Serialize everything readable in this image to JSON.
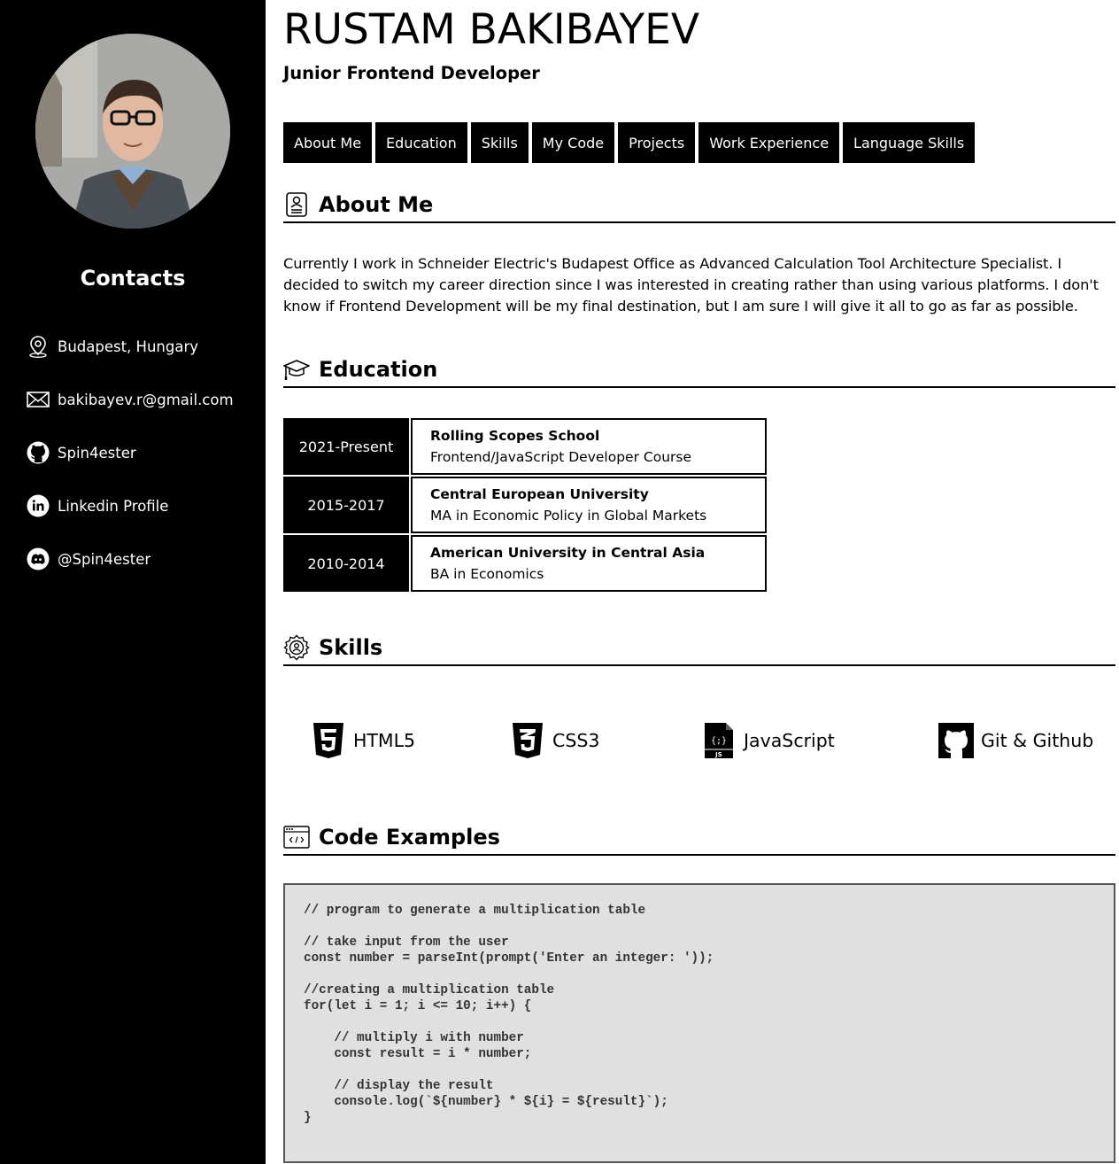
{
  "profile": {
    "name": "RUSTAM BAKIBAYEV",
    "role": "Junior Frontend Developer"
  },
  "sidebar": {
    "contacts_title": "Contacts",
    "contacts": [
      {
        "icon": "location-pin-icon",
        "label": "Budapest, Hungary"
      },
      {
        "icon": "envelope-icon",
        "label": "bakibayev.r@gmail.com"
      },
      {
        "icon": "github-icon",
        "label": "Spin4ester"
      },
      {
        "icon": "linkedin-icon",
        "label": "Linkedin Profile"
      },
      {
        "icon": "discord-icon",
        "label": "@Spin4ester"
      }
    ]
  },
  "nav": {
    "items": [
      "About Me",
      "Education",
      "Skills",
      "My Code",
      "Projects",
      "Work Experience",
      "Language Skills"
    ]
  },
  "about": {
    "title": "About Me",
    "icon": "profile-card-icon",
    "text": "Currently I work in Schneider Electric's Budapest Office as Advanced Calculation Tool Architecture Specialist. I decided to switch my career direction since I was interested in creating rather than using various platforms. I don't know if Frontend Development will be my final destination, but I am sure I will give it all to go as far as possible."
  },
  "education": {
    "title": "Education",
    "icon": "graduation-cap-icon",
    "rows": [
      {
        "years": "2021-Present",
        "school": "Rolling Scopes School",
        "course": "Frontend/JavaScript Developer Course"
      },
      {
        "years": "2015-2017",
        "school": "Central European University",
        "course": "MA in Economic Policy in Global Markets"
      },
      {
        "years": "2010-2014",
        "school": "American University in Central Asia",
        "course": "BA in Economics"
      }
    ]
  },
  "skills": {
    "title": "Skills",
    "icon": "gear-icon",
    "items": [
      {
        "icon": "html5-icon",
        "label": "HTML5"
      },
      {
        "icon": "css3-icon",
        "label": "CSS3"
      },
      {
        "icon": "javascript-file-icon",
        "label": "JavaScript"
      },
      {
        "icon": "github-icon",
        "label": "Git & Github"
      }
    ]
  },
  "code": {
    "title": "Code Examples",
    "icon": "code-window-icon",
    "snippet": "// program to generate a multiplication table\n\n// take input from the user\nconst number = parseInt(prompt('Enter an integer: '));\n\n//creating a multiplication table\nfor(let i = 1; i <= 10; i++) {\n\n    // multiply i with number\n    const result = i * number;\n\n    // display the result\n    console.log(`${number} * ${i} = ${result}`);\n}"
  }
}
